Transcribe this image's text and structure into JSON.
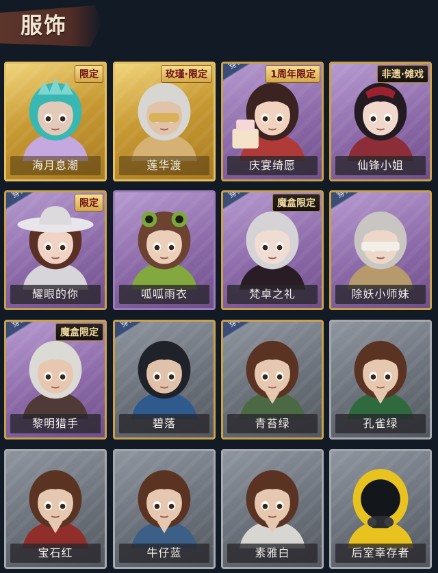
{
  "header": {
    "title": "服饰"
  },
  "equipped_label": "穿戴",
  "cards": [
    {
      "name": "海月息潮",
      "badge": "限定",
      "style": "gold",
      "equipped": false,
      "skin": "#e2c9b8",
      "hair": "#38b7b3",
      "outfit": "#c6a8e0",
      "icon": "crown-portrait-icon"
    },
    {
      "name": "莲华渡",
      "badge": "玫瑾·限定",
      "style": "gold",
      "equipped": false,
      "skin": "#e0c3a8",
      "hair": "#d8d6d2",
      "outfit": "#d5b173",
      "icon": "masked-portrait-icon"
    },
    {
      "name": "庆宴绮愿",
      "badge": "1周年限定",
      "style": "purple",
      "equipped": true,
      "skin": "#f0d2bf",
      "hair": "#3a2320",
      "outfit": "#b03a38",
      "icon": "cake-portrait-icon"
    },
    {
      "name": "仙锋小姐",
      "badge": "非遗·傩戏",
      "style": "purple",
      "equipped": false,
      "skin": "#f1d8cc",
      "hair": "#231b22",
      "outfit": "#8c2d38",
      "icon": "opera-portrait-icon"
    },
    {
      "name": "耀眼的你",
      "badge": "限定",
      "style": "purple",
      "equipped": true,
      "skin": "#f0d3c4",
      "hair": "#5b3024",
      "outfit": "#d8d5da",
      "icon": "cowboy-hat-portrait-icon"
    },
    {
      "name": "呱呱雨衣",
      "badge": "",
      "style": "purple",
      "equipped": false,
      "skin": "#ebcfb8",
      "hair": "#6b4330",
      "outfit": "#83a83e",
      "icon": "frog-hat-portrait-icon"
    },
    {
      "name": "梵卓之礼",
      "badge": "魔盒限定",
      "style": "purple",
      "equipped": true,
      "skin": "#efdcd3",
      "hair": "#d5d3d6",
      "outfit": "#2a1c24",
      "icon": "vampire-portrait-icon"
    },
    {
      "name": "除妖小师妹",
      "badge": "",
      "style": "purple",
      "equipped": true,
      "skin": "#ecd7c8",
      "hair": "#c8c5c2",
      "outfit": "#b79a6c",
      "icon": "blindfold-portrait-icon"
    },
    {
      "name": "黎明猎手",
      "badge": "魔盒限定",
      "style": "purple",
      "equipped": true,
      "skin": "#e8c7b0",
      "hair": "#dcdad4",
      "outfit": "#4f3a38",
      "icon": "hunter-portrait-icon"
    },
    {
      "name": "碧落",
      "badge": "",
      "style": "grey",
      "equipped": true,
      "skin": "#dfc2a9",
      "hair": "#1f2228",
      "outfit": "#2f5a8e",
      "icon": "boy-portrait-icon"
    },
    {
      "name": "青苔绿",
      "badge": "",
      "style": "grey",
      "equipped": true,
      "skin": "#e6c8b0",
      "hair": "#5a3322",
      "outfit": "#4b6a44",
      "icon": "girl-portrait-icon"
    },
    {
      "name": "孔雀绿",
      "badge": "",
      "style": "grey",
      "equipped": false,
      "skin": "#e6c8b0",
      "hair": "#5a3322",
      "outfit": "#2f6a3e",
      "icon": "girl-portrait-icon"
    },
    {
      "name": "宝石红",
      "badge": "",
      "style": "grey",
      "equipped": false,
      "skin": "#e6c8b0",
      "hair": "#5a3322",
      "outfit": "#8f2e2b",
      "icon": "girl-portrait-icon"
    },
    {
      "name": "牛仔蓝",
      "badge": "",
      "style": "grey",
      "equipped": false,
      "skin": "#e6c8b0",
      "hair": "#5a3322",
      "outfit": "#3b5f86",
      "icon": "girl-portrait-icon"
    },
    {
      "name": "素雅白",
      "badge": "",
      "style": "grey",
      "equipped": false,
      "skin": "#e6c8b0",
      "hair": "#5a3322",
      "outfit": "#d7d6d2",
      "icon": "girl-portrait-icon"
    },
    {
      "name": "后室幸存者",
      "badge": "",
      "style": "grey",
      "equipped": false,
      "skin": "#1a1d22",
      "hair": "#e8c320",
      "outfit": "#e8c320",
      "icon": "hazmat-portrait-icon"
    }
  ]
}
